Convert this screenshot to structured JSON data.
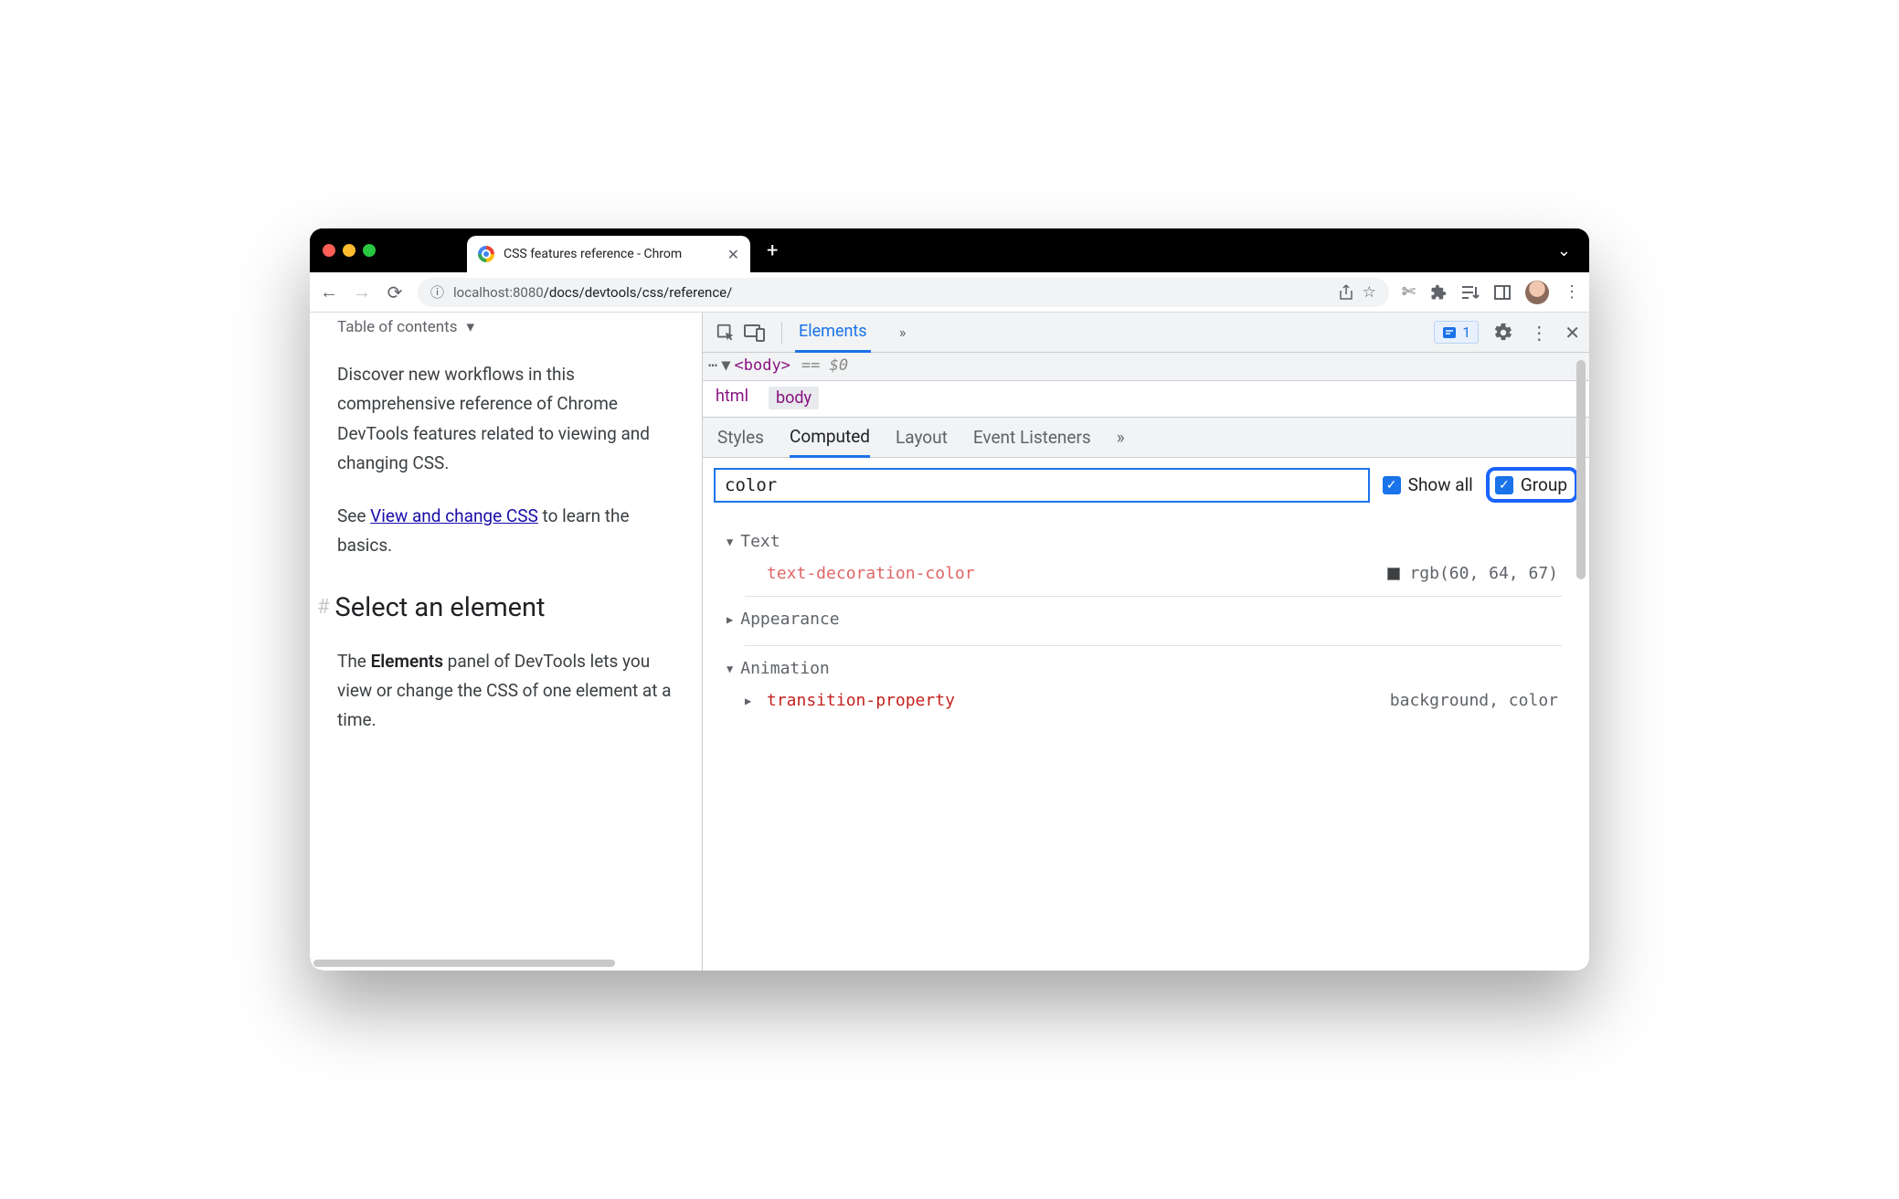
{
  "browser": {
    "tab_title": "CSS features reference - Chrom",
    "url_host": "localhost",
    "url_port": ":8080",
    "url_path": "/docs/devtools/css/reference/"
  },
  "page": {
    "toc_label": "Table of contents",
    "para1_a": "Discover new workflows in this comprehensive reference of Chrome DevTools features related to viewing and changing CSS.",
    "para2_prefix": "See ",
    "para2_link": "View and change CSS",
    "para2_suffix": " to learn the basics.",
    "heading": "Select an element",
    "para3_prefix": "The ",
    "para3_bold": "Elements",
    "para3_suffix": " panel of DevTools lets you view or change the CSS of one element at a time."
  },
  "devtools": {
    "main_tab": "Elements",
    "issues_count": "1",
    "dom_tag": "<body>",
    "dom_eq": "== $0",
    "crumbs": {
      "html": "html",
      "body": "body"
    },
    "subtabs": {
      "styles": "Styles",
      "computed": "Computed",
      "layout": "Layout",
      "listeners": "Event Listeners"
    },
    "filter_value": "color",
    "show_all_label": "Show all",
    "group_label": "Group",
    "groups": {
      "text": {
        "label": "Text",
        "prop": "text-decoration-color",
        "val": "rgb(60, 64, 67)"
      },
      "appearance": {
        "label": "Appearance"
      },
      "animation": {
        "label": "Animation",
        "prop": "transition-property",
        "val": "background, color"
      }
    }
  }
}
